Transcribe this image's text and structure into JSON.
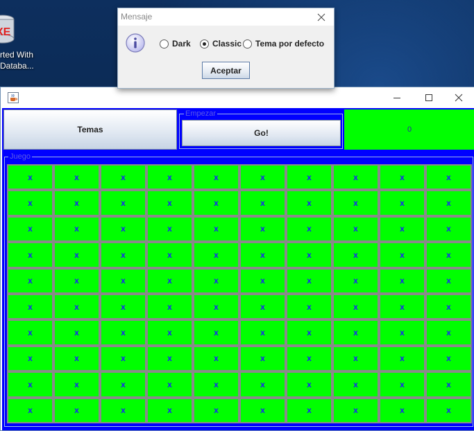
{
  "desktop": {
    "icon_name": "database-icon",
    "icon_label_line1": "rted With",
    "icon_label_line2": "Databa..."
  },
  "app": {
    "window_icon": "java-cup-icon",
    "temas_label": "Temas",
    "empezar_legend": "Empezar",
    "go_label": "Go!",
    "score_value": "0",
    "juego_legend": "Juego",
    "cell_symbol": "x",
    "rows": 10,
    "cols": 10,
    "colors": {
      "panel_bg": "#0000ff",
      "cell_bg": "#00ff00",
      "cell_text": "#1a1aff",
      "score_bg": "#00ff00"
    }
  },
  "dialog": {
    "title": "Mensaje",
    "icon": "info-icon",
    "options": [
      "Dark",
      "Classic",
      "Tema por defecto"
    ],
    "selected": "Classic",
    "accept_label": "Aceptar"
  }
}
